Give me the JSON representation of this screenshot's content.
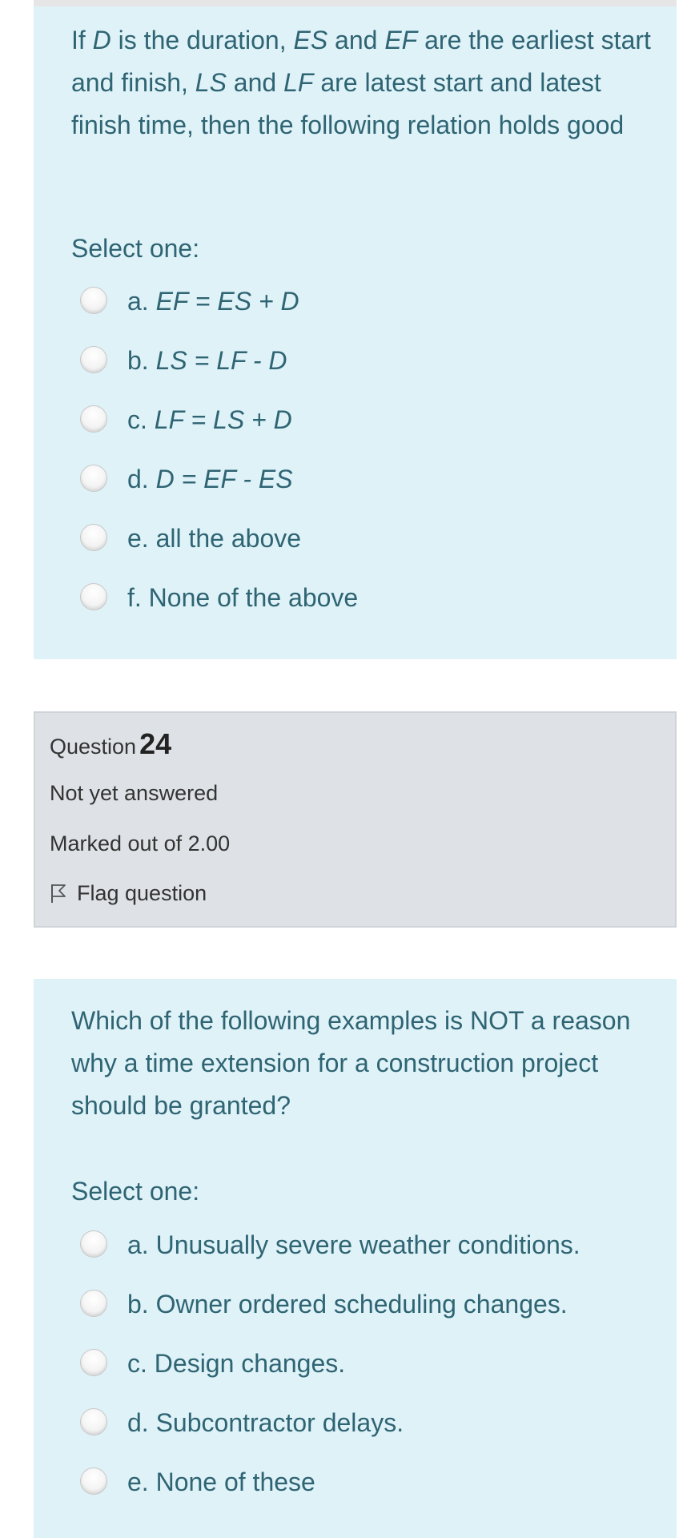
{
  "q23": {
    "text_parts": [
      "If ",
      "D",
      " is the duration, ",
      "ES",
      " and ",
      "EF",
      " are the earliest start and finish, ",
      "LS",
      " and ",
      "LF",
      " are latest start and latest finish time, then the following relation holds good"
    ],
    "select_one": "Select one:",
    "options": [
      {
        "letter": "a.",
        "formula": "EF = ES + D"
      },
      {
        "letter": "b.",
        "formula": "LS = LF - D"
      },
      {
        "letter": "c.",
        "formula": "LF = LS + D"
      },
      {
        "letter": "d.",
        "formula": "D = EF - ES"
      },
      {
        "letter": "e.",
        "text": "all the above"
      },
      {
        "letter": "f.",
        "text": "None of the above"
      }
    ]
  },
  "q24_info": {
    "question_label": "Question",
    "question_number": "24",
    "state": "Not yet answered",
    "grade": "Marked out of 2.00",
    "flag_label": "Flag question"
  },
  "q24": {
    "text": "Which of the following examples is NOT a reason why a time extension for a construction project should be granted?",
    "select_one": "Select one:",
    "options": [
      "a. Unusually severe weather conditions.",
      "b. Owner ordered scheduling changes.",
      "c. Design changes.",
      "d. Subcontractor delays.",
      "e. None of these"
    ]
  }
}
